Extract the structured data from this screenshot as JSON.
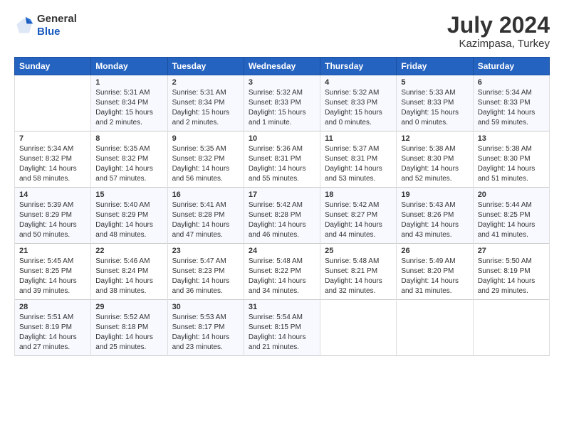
{
  "logo": {
    "general": "General",
    "blue": "Blue"
  },
  "title": "July 2024",
  "location": "Kazimpasa, Turkey",
  "days_header": [
    "Sunday",
    "Monday",
    "Tuesday",
    "Wednesday",
    "Thursday",
    "Friday",
    "Saturday"
  ],
  "weeks": [
    [
      {
        "day": "",
        "info": ""
      },
      {
        "day": "1",
        "info": "Sunrise: 5:31 AM\nSunset: 8:34 PM\nDaylight: 15 hours\nand 2 minutes."
      },
      {
        "day": "2",
        "info": "Sunrise: 5:31 AM\nSunset: 8:34 PM\nDaylight: 15 hours\nand 2 minutes."
      },
      {
        "day": "3",
        "info": "Sunrise: 5:32 AM\nSunset: 8:33 PM\nDaylight: 15 hours\nand 1 minute."
      },
      {
        "day": "4",
        "info": "Sunrise: 5:32 AM\nSunset: 8:33 PM\nDaylight: 15 hours\nand 0 minutes."
      },
      {
        "day": "5",
        "info": "Sunrise: 5:33 AM\nSunset: 8:33 PM\nDaylight: 15 hours\nand 0 minutes."
      },
      {
        "day": "6",
        "info": "Sunrise: 5:34 AM\nSunset: 8:33 PM\nDaylight: 14 hours\nand 59 minutes."
      }
    ],
    [
      {
        "day": "7",
        "info": "Sunrise: 5:34 AM\nSunset: 8:32 PM\nDaylight: 14 hours\nand 58 minutes."
      },
      {
        "day": "8",
        "info": "Sunrise: 5:35 AM\nSunset: 8:32 PM\nDaylight: 14 hours\nand 57 minutes."
      },
      {
        "day": "9",
        "info": "Sunrise: 5:35 AM\nSunset: 8:32 PM\nDaylight: 14 hours\nand 56 minutes."
      },
      {
        "day": "10",
        "info": "Sunrise: 5:36 AM\nSunset: 8:31 PM\nDaylight: 14 hours\nand 55 minutes."
      },
      {
        "day": "11",
        "info": "Sunrise: 5:37 AM\nSunset: 8:31 PM\nDaylight: 14 hours\nand 53 minutes."
      },
      {
        "day": "12",
        "info": "Sunrise: 5:38 AM\nSunset: 8:30 PM\nDaylight: 14 hours\nand 52 minutes."
      },
      {
        "day": "13",
        "info": "Sunrise: 5:38 AM\nSunset: 8:30 PM\nDaylight: 14 hours\nand 51 minutes."
      }
    ],
    [
      {
        "day": "14",
        "info": "Sunrise: 5:39 AM\nSunset: 8:29 PM\nDaylight: 14 hours\nand 50 minutes."
      },
      {
        "day": "15",
        "info": "Sunrise: 5:40 AM\nSunset: 8:29 PM\nDaylight: 14 hours\nand 48 minutes."
      },
      {
        "day": "16",
        "info": "Sunrise: 5:41 AM\nSunset: 8:28 PM\nDaylight: 14 hours\nand 47 minutes."
      },
      {
        "day": "17",
        "info": "Sunrise: 5:42 AM\nSunset: 8:28 PM\nDaylight: 14 hours\nand 46 minutes."
      },
      {
        "day": "18",
        "info": "Sunrise: 5:42 AM\nSunset: 8:27 PM\nDaylight: 14 hours\nand 44 minutes."
      },
      {
        "day": "19",
        "info": "Sunrise: 5:43 AM\nSunset: 8:26 PM\nDaylight: 14 hours\nand 43 minutes."
      },
      {
        "day": "20",
        "info": "Sunrise: 5:44 AM\nSunset: 8:25 PM\nDaylight: 14 hours\nand 41 minutes."
      }
    ],
    [
      {
        "day": "21",
        "info": "Sunrise: 5:45 AM\nSunset: 8:25 PM\nDaylight: 14 hours\nand 39 minutes."
      },
      {
        "day": "22",
        "info": "Sunrise: 5:46 AM\nSunset: 8:24 PM\nDaylight: 14 hours\nand 38 minutes."
      },
      {
        "day": "23",
        "info": "Sunrise: 5:47 AM\nSunset: 8:23 PM\nDaylight: 14 hours\nand 36 minutes."
      },
      {
        "day": "24",
        "info": "Sunrise: 5:48 AM\nSunset: 8:22 PM\nDaylight: 14 hours\nand 34 minutes."
      },
      {
        "day": "25",
        "info": "Sunrise: 5:48 AM\nSunset: 8:21 PM\nDaylight: 14 hours\nand 32 minutes."
      },
      {
        "day": "26",
        "info": "Sunrise: 5:49 AM\nSunset: 8:20 PM\nDaylight: 14 hours\nand 31 minutes."
      },
      {
        "day": "27",
        "info": "Sunrise: 5:50 AM\nSunset: 8:19 PM\nDaylight: 14 hours\nand 29 minutes."
      }
    ],
    [
      {
        "day": "28",
        "info": "Sunrise: 5:51 AM\nSunset: 8:19 PM\nDaylight: 14 hours\nand 27 minutes."
      },
      {
        "day": "29",
        "info": "Sunrise: 5:52 AM\nSunset: 8:18 PM\nDaylight: 14 hours\nand 25 minutes."
      },
      {
        "day": "30",
        "info": "Sunrise: 5:53 AM\nSunset: 8:17 PM\nDaylight: 14 hours\nand 23 minutes."
      },
      {
        "day": "31",
        "info": "Sunrise: 5:54 AM\nSunset: 8:15 PM\nDaylight: 14 hours\nand 21 minutes."
      },
      {
        "day": "",
        "info": ""
      },
      {
        "day": "",
        "info": ""
      },
      {
        "day": "",
        "info": ""
      }
    ]
  ]
}
